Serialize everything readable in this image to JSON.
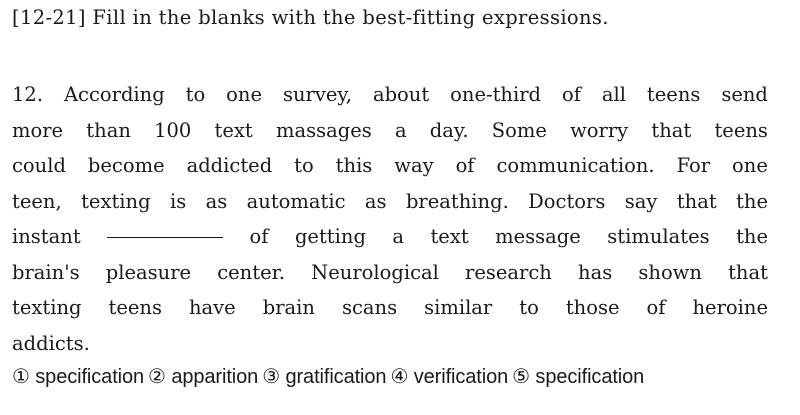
{
  "instruction": "[12-21] Fill in the blanks with the best-fitting expressions.",
  "question": {
    "lines": [
      "12. According to one survey, about one-third of all teens send",
      "more than 100 text massages a day. Some worry that teens",
      "could become addicted to this way of communication. For one",
      "teen, texting is as automatic as breathing. Doctors say that the",
      "instant ________ of getting a text message stimulates the",
      "brain's pleasure center. Neurological research has shown that",
      "texting teens have brain scans similar to those of heroine",
      "addicts."
    ]
  },
  "choices": [
    "① specification",
    "② apparition",
    "③ gratification",
    "④ verification",
    "⑤ specification"
  ]
}
